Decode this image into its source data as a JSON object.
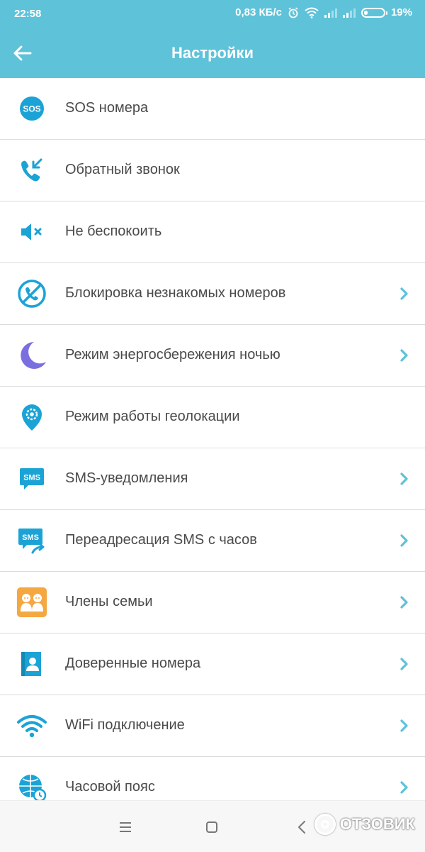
{
  "status_bar": {
    "time": "22:58",
    "speed": "0,83 КБ/с",
    "battery": "19%",
    "battery_level": 0.19
  },
  "header": {
    "title": "Настройки",
    "back_icon": "arrow-left-icon"
  },
  "settings": {
    "items": [
      {
        "label": "SOS номера",
        "icon": "sos-icon",
        "chevron": false
      },
      {
        "label": "Обратный звонок",
        "icon": "callback-phone-icon",
        "chevron": false
      },
      {
        "label": "Не беспокоить",
        "icon": "speaker-mute-icon",
        "chevron": false
      },
      {
        "label": "Блокировка незнакомых номеров",
        "icon": "blocked-phone-icon",
        "chevron": true
      },
      {
        "label": "Режим энергосбережения ночью",
        "icon": "moon-icon",
        "chevron": true
      },
      {
        "label": "Режим работы геолокации",
        "icon": "location-gear-icon",
        "chevron": false
      },
      {
        "label": "SMS-уведомления",
        "icon": "sms-icon",
        "chevron": true
      },
      {
        "label": "Переадресация SMS с часов",
        "icon": "sms-forward-icon",
        "chevron": true
      },
      {
        "label": "Члены семьи",
        "icon": "family-icon",
        "chevron": true
      },
      {
        "label": "Доверенные номера",
        "icon": "contact-book-icon",
        "chevron": true
      },
      {
        "label": "WiFi подключение",
        "icon": "wifi-icon",
        "chevron": true
      },
      {
        "label": "Часовой пояс",
        "icon": "globe-clock-icon",
        "chevron": true
      }
    ]
  },
  "icon_texts": {
    "sos": "SOS",
    "sms": "SMS"
  },
  "navbar": {
    "menu_icon": "menu-lines-icon",
    "home_icon": "square-home-icon",
    "back_icon": "triangle-back-icon"
  },
  "watermark": {
    "text": "ОТЗОВИК"
  },
  "colors": {
    "accent": "#5ec2d9",
    "icon_blue": "#1ba3d6",
    "moon": "#7b6fe0",
    "family_orange": "#f5a742",
    "chevron": "#5ec2d9",
    "divider": "#dcdcdc"
  }
}
